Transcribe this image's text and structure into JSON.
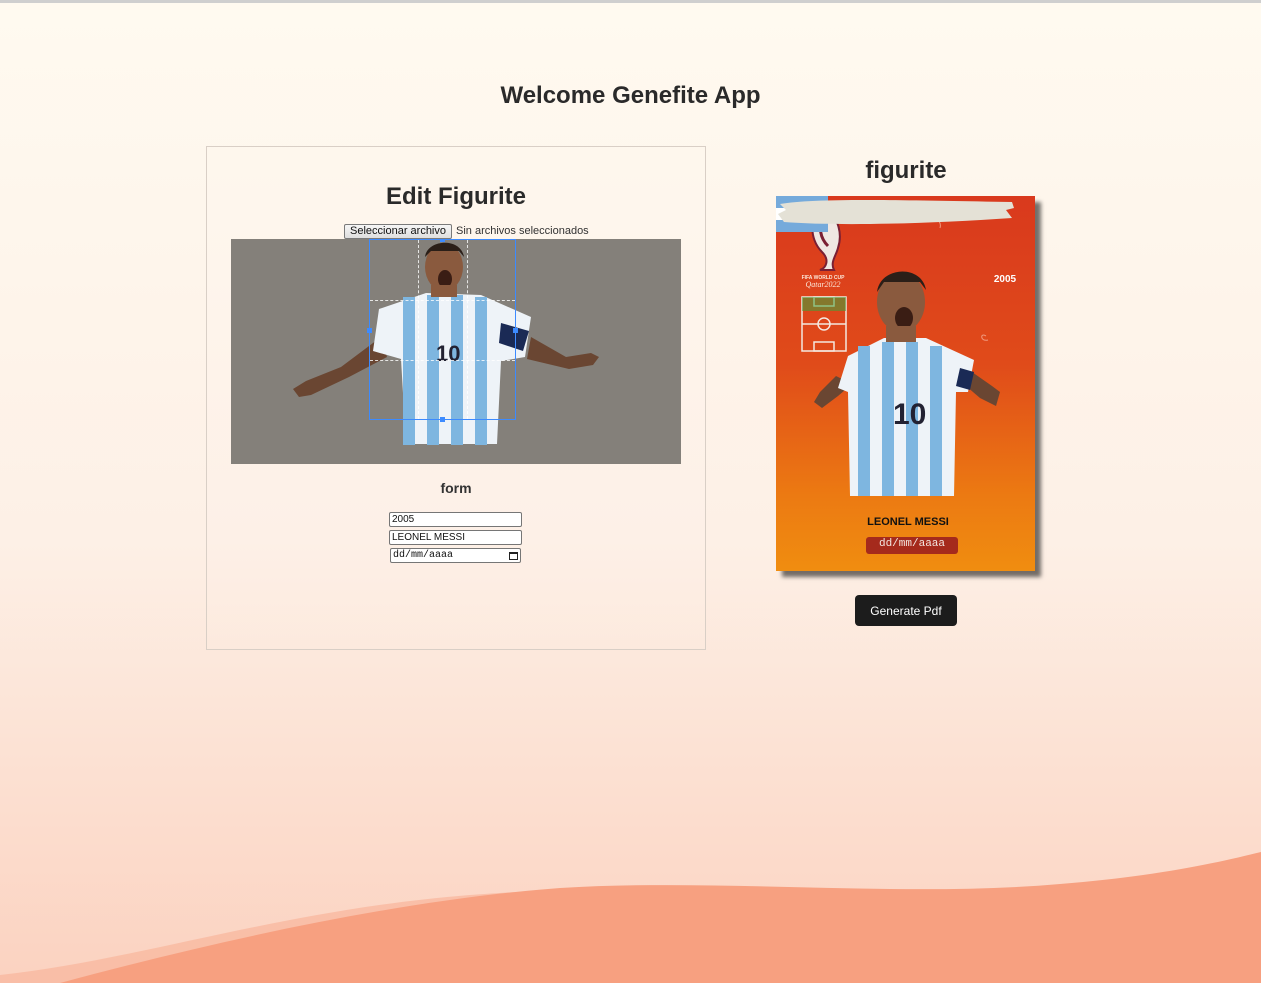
{
  "app": {
    "title": "Welcome Genefite App"
  },
  "editor": {
    "title": "Edit Figurite",
    "file_button_label": "Seleccionar archivo",
    "file_status": "Sin archivos seleccionados",
    "form_title": "form",
    "fields": {
      "year_value": "2005",
      "name_value": "LEONEL MESSI",
      "date_placeholder": "dd/mm/aaaa"
    }
  },
  "card": {
    "title": "figurite",
    "year": "2005",
    "name": "LEONEL MESSI",
    "date": "dd/mm/aaaa",
    "logo_text": "FIFA WORLD CUP Qatar2022"
  },
  "actions": {
    "generate_pdf_label": "Generate Pdf"
  },
  "colors": {
    "card_top": "#d9391d",
    "card_bottom": "#f08d10",
    "crop_border": "#3d8bff",
    "button_bg": "#1c1c1c",
    "wave": "#f7a080"
  },
  "icons": [
    "calendar-icon",
    "world-cup-trophy-icon",
    "argentina-flag-icon",
    "football-pitch-icon"
  ]
}
